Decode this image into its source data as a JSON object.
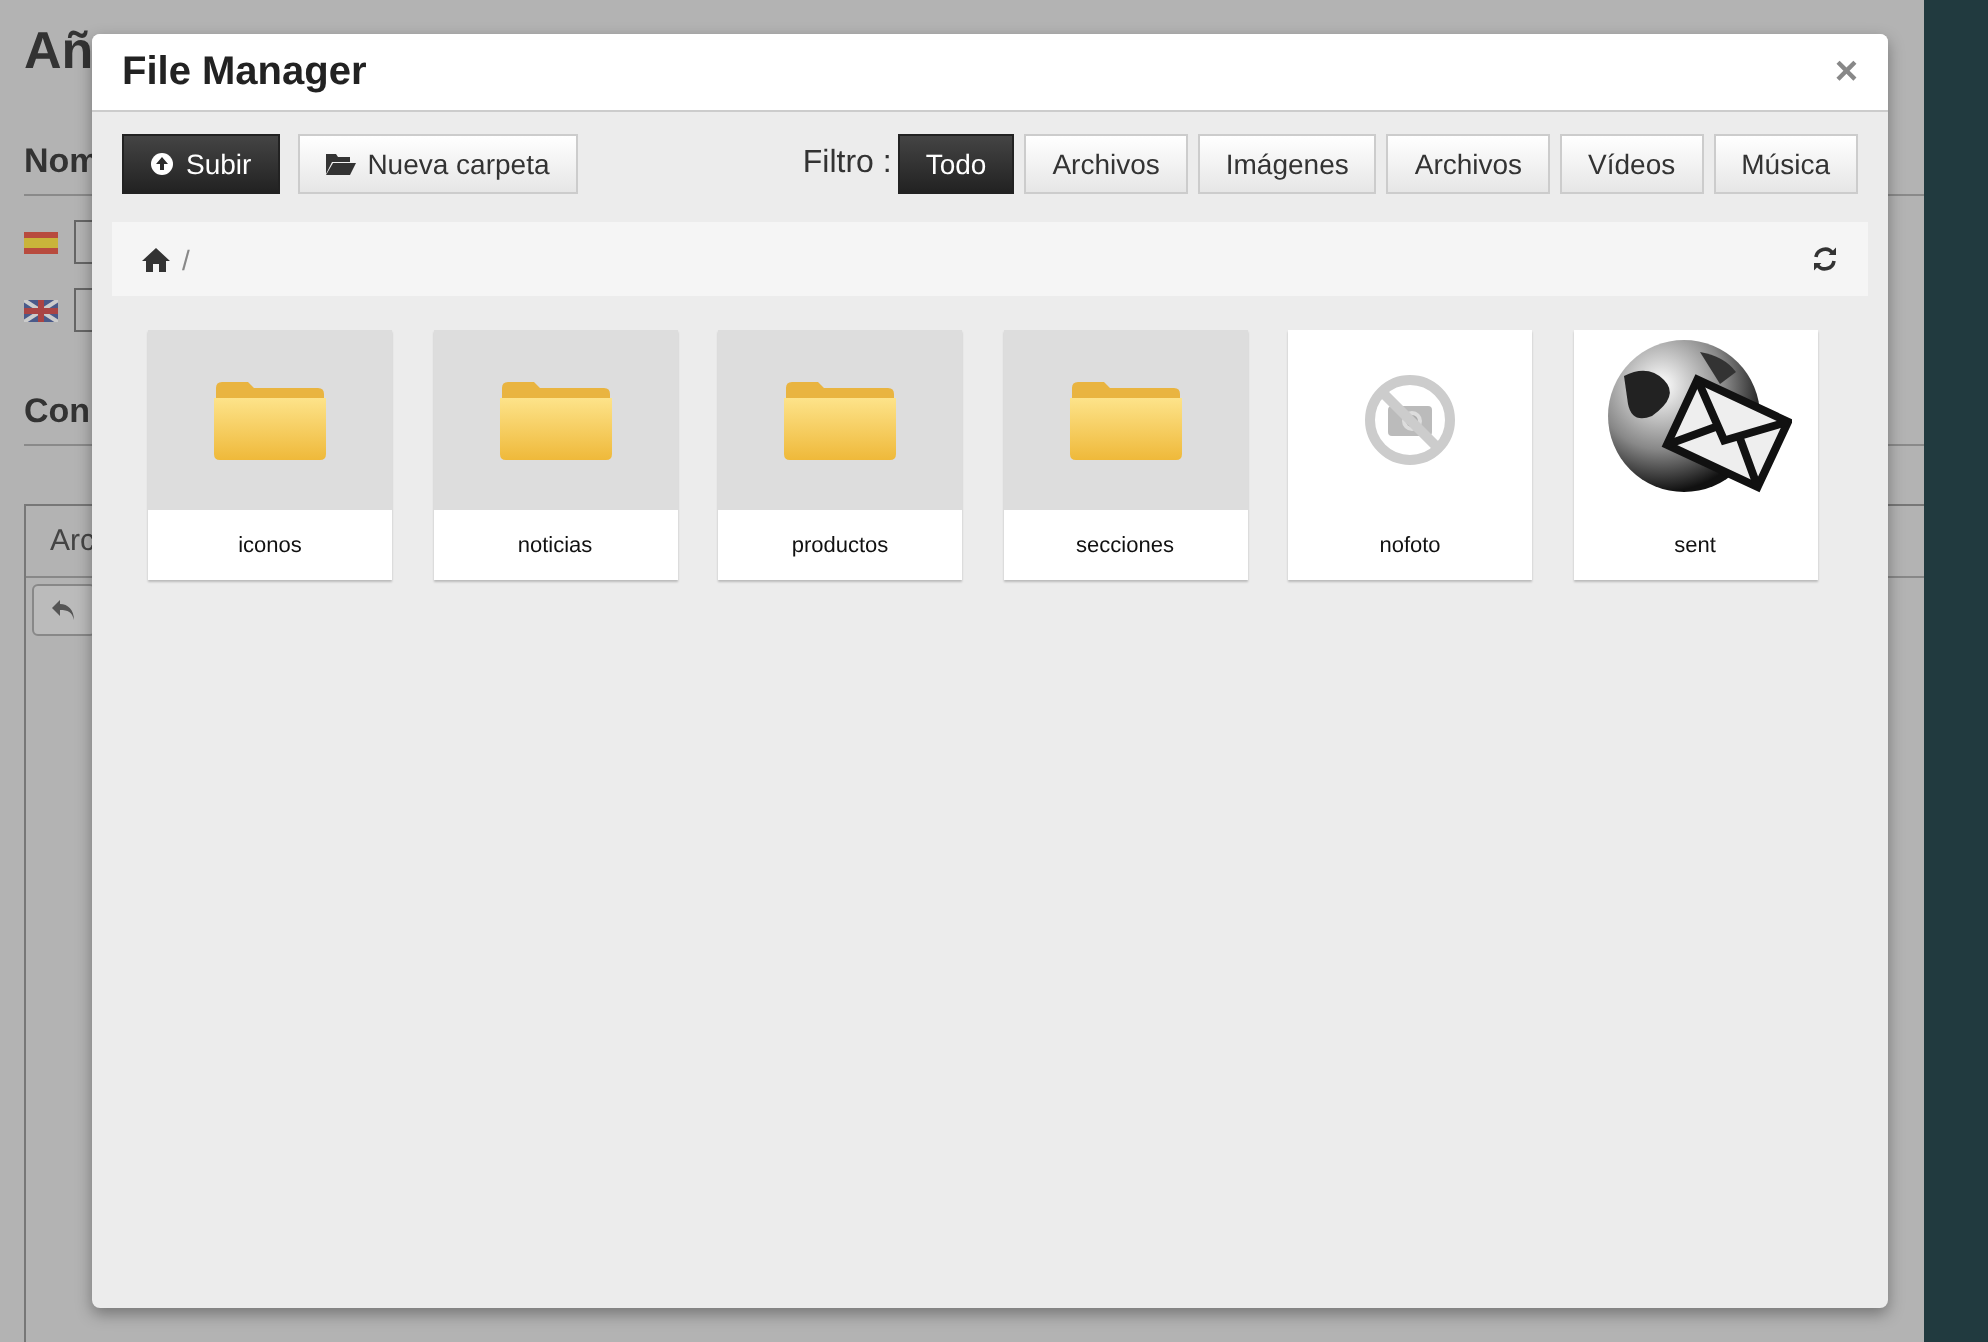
{
  "background_page": {
    "heading": "Añ",
    "sections": [
      {
        "label": "Nom"
      },
      {
        "label": "Con"
      }
    ],
    "tab": "Arc"
  },
  "dialog": {
    "title": "File Manager",
    "close": "×",
    "actions": [
      {
        "label": "Subir",
        "kind": "upload",
        "primary": true
      },
      {
        "label": "Nueva carpeta",
        "kind": "folder",
        "primary": false
      }
    ],
    "filter_label": "Filtro :",
    "filters": [
      {
        "label": "Todo",
        "selected": true
      },
      {
        "label": "Archivos",
        "selected": false
      },
      {
        "label": "Imágenes",
        "selected": false
      },
      {
        "label": "Archivos",
        "selected": false
      },
      {
        "label": "Vídeos",
        "selected": false
      },
      {
        "label": "Música",
        "selected": false
      }
    ],
    "breadcrumb": {
      "separator": "/"
    },
    "items": [
      {
        "name": "iconos",
        "kind": "folder"
      },
      {
        "name": "noticias",
        "kind": "folder"
      },
      {
        "name": "productos",
        "kind": "folder"
      },
      {
        "name": "secciones",
        "kind": "folder"
      },
      {
        "name": "nofoto",
        "kind": "nophoto"
      },
      {
        "name": "sent",
        "kind": "mail"
      }
    ]
  }
}
